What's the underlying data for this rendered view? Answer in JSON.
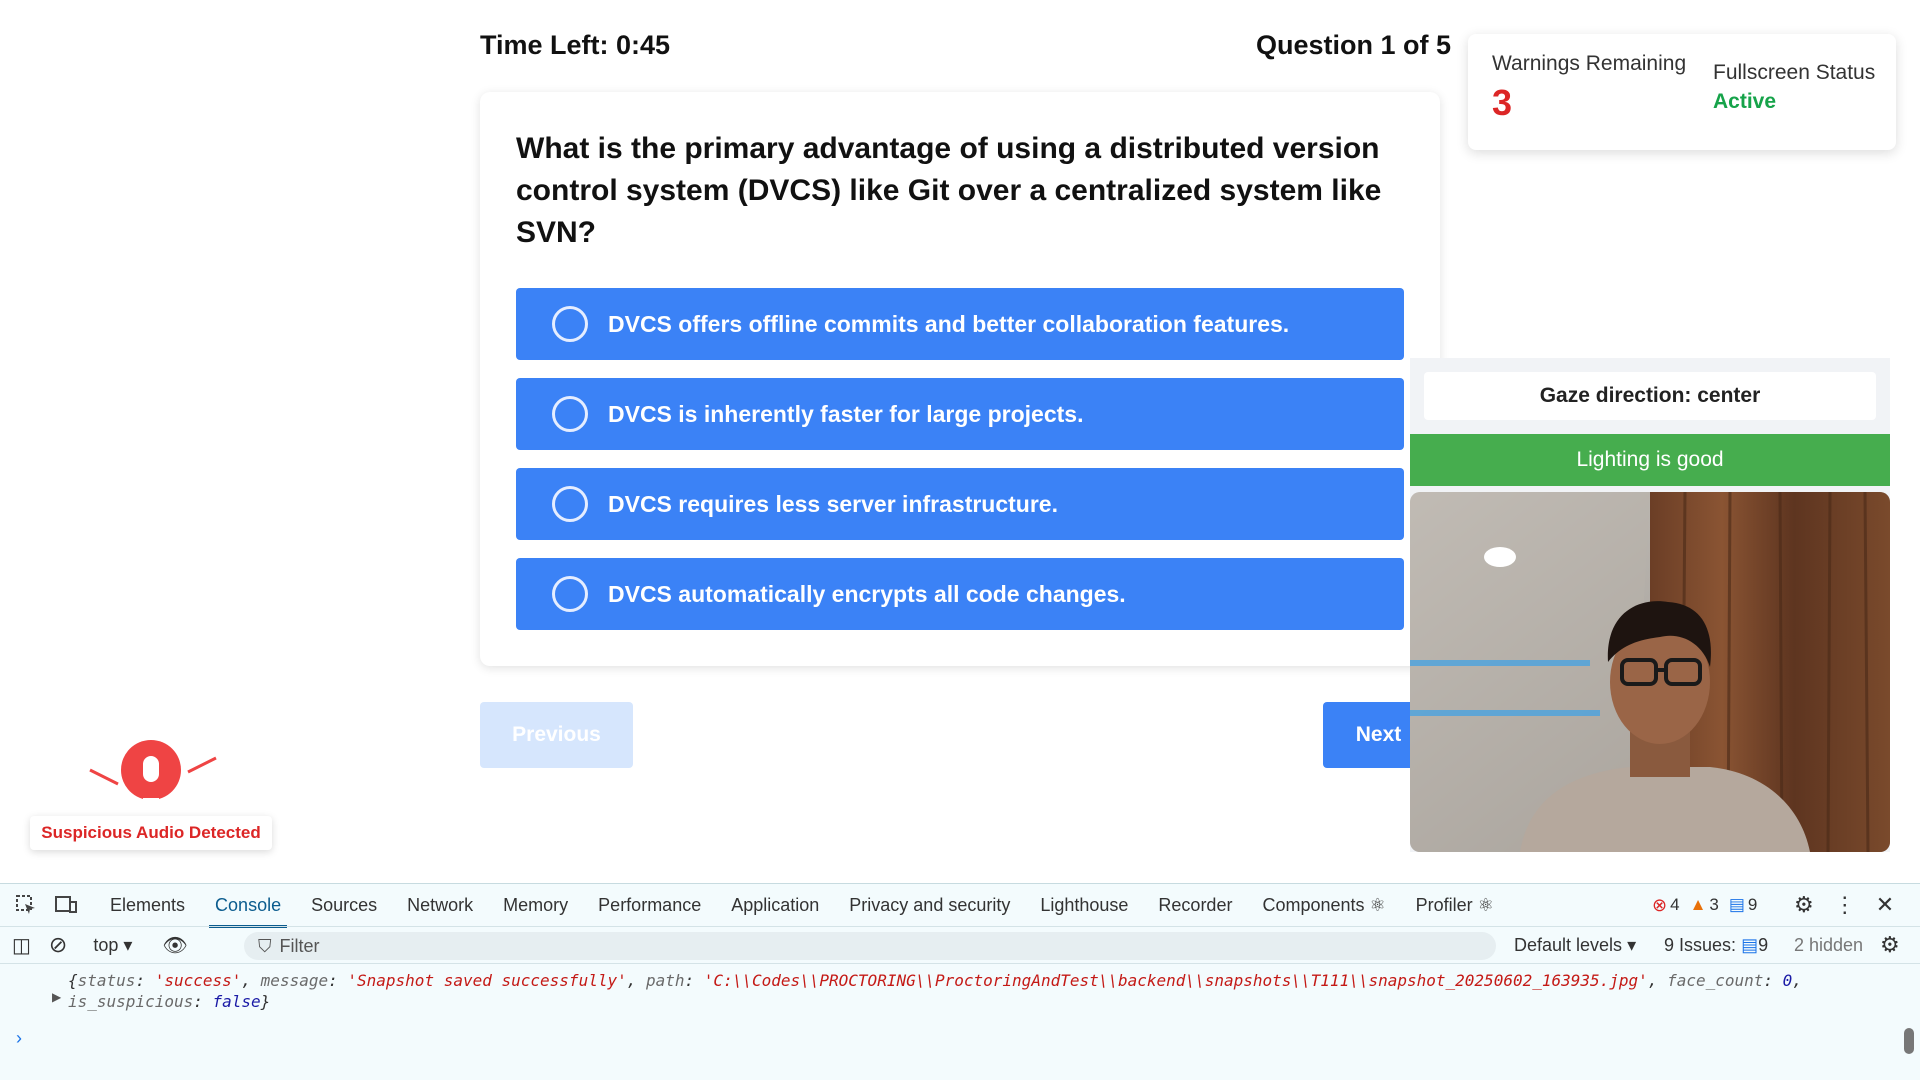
{
  "header": {
    "timer": "Time Left: 0:45",
    "question_count": "Question 1 of 5"
  },
  "status": {
    "warnings_label": "Warnings Remaining",
    "warnings_count": "3",
    "fullscreen_label": "Fullscreen Status",
    "fullscreen_value": "Active"
  },
  "question": {
    "text": "What is the primary advantage of using a distributed version control system (DVCS) like Git over a centralized system like SVN?",
    "options": [
      "DVCS offers offline commits and better collaboration features.",
      "DVCS is inherently faster for large projects.",
      "DVCS requires less server infrastructure.",
      "DVCS automatically encrypts all code changes."
    ]
  },
  "nav": {
    "previous": "Previous",
    "next": "Next"
  },
  "camera": {
    "gaze": "Gaze direction: center",
    "lighting": "Lighting is good"
  },
  "audio_alert": "Suspicious Audio Detected",
  "devtools": {
    "tabs": [
      "Elements",
      "Console",
      "Sources",
      "Network",
      "Memory",
      "Performance",
      "Application",
      "Privacy and security",
      "Lighthouse",
      "Recorder",
      "Components ⚛",
      "Profiler ⚛"
    ],
    "errors": "4",
    "warnings": "3",
    "messages": "9",
    "context": "top",
    "filter_placeholder": "Filter",
    "levels": "Default levels",
    "issues_label": "9 Issues:",
    "issues_count": "9",
    "hidden": "2 hidden",
    "log": {
      "status_key": "status",
      "status_val": "'success'",
      "message_key": "message",
      "message_val": "'Snapshot saved successfully'",
      "path_key": "path",
      "path_val": "'C:\\\\Codes\\\\PROCTORING\\\\ProctoringAndTest\\\\backend\\\\snapshots\\\\T111\\\\snapshot_20250602_163935.jpg'",
      "face_key": "face_count",
      "face_val": "0",
      "susp_key": "is_suspicious",
      "susp_val": "false"
    }
  },
  "colors": {
    "accent": "#3b82f6",
    "danger": "#dc2626",
    "success": "#16a34a",
    "lighting_bg": "#46ad4e"
  }
}
